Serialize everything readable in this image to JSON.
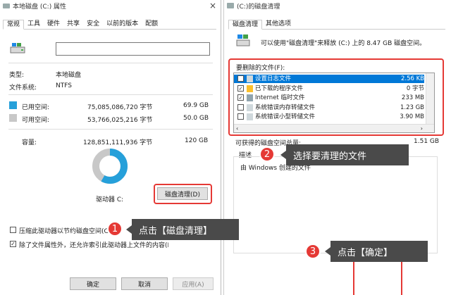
{
  "props": {
    "title": "本地磁盘 (C:) 属性",
    "tabs": [
      "常规",
      "工具",
      "硬件",
      "共享",
      "安全",
      "以前的版本",
      "配额"
    ],
    "type_label": "类型:",
    "type_value": "本地磁盘",
    "fs_label": "文件系统:",
    "fs_value": "NTFS",
    "used_label": "已用空间:",
    "used_bytes": "75,085,086,720 字节",
    "used_gb": "69.9 GB",
    "free_label": "可用空间:",
    "free_bytes": "53,766,025,216 字节",
    "free_gb": "50.0 GB",
    "cap_label": "容量:",
    "cap_bytes": "128,851,111,936 字节",
    "cap_gb": "120 GB",
    "drive_label": "驱动器 C:",
    "cleanup_button": "磁盘清理(D)",
    "compress_label": "压缩此驱动器以节约磁盘空间(C)",
    "index_label": "除了文件属性外，还允许索引此驱动器上文件的内容(I)",
    "ok": "确定",
    "cancel": "取消",
    "apply": "应用(A)",
    "used_fraction": 0.583,
    "colors": {
      "used": "#26a0da",
      "free": "#c8c8c8"
    }
  },
  "cleanup": {
    "title": "(C:)的磁盘清理",
    "tabs": [
      "磁盘清理",
      "其他选项"
    ],
    "intro": "可以使用\"磁盘清理\"来释放 (C:) 上的 8.47 GB 磁盘空间。",
    "files_label": "要删除的文件(F):",
    "files": [
      {
        "name": "设置日志文件",
        "size": "2.56 KB",
        "checked": false,
        "selected": true
      },
      {
        "name": "已下载的程序文件",
        "size": "0 字节",
        "checked": true,
        "selected": false
      },
      {
        "name": "Internet 临时文件",
        "size": "233 MB",
        "checked": true,
        "selected": false
      },
      {
        "name": "系统错误内存转储文件",
        "size": "1.23 GB",
        "checked": false,
        "selected": false
      },
      {
        "name": "系统错误小型转储文件",
        "size": "3.90 MB",
        "checked": false,
        "selected": false
      }
    ],
    "gain_label": "可获得的磁盘空间总量:",
    "gain_value": "1.51 GB",
    "desc_label": "描述",
    "desc_text": "由 Windows 创建的文件"
  },
  "annotations": {
    "step1_num": "1",
    "step1_text": "点击【磁盘清理】",
    "step2_num": "2",
    "step2_text": "选择要清理的文件",
    "step3_num": "3",
    "step3_text": "点击【确定】",
    "color": "#e53935"
  }
}
